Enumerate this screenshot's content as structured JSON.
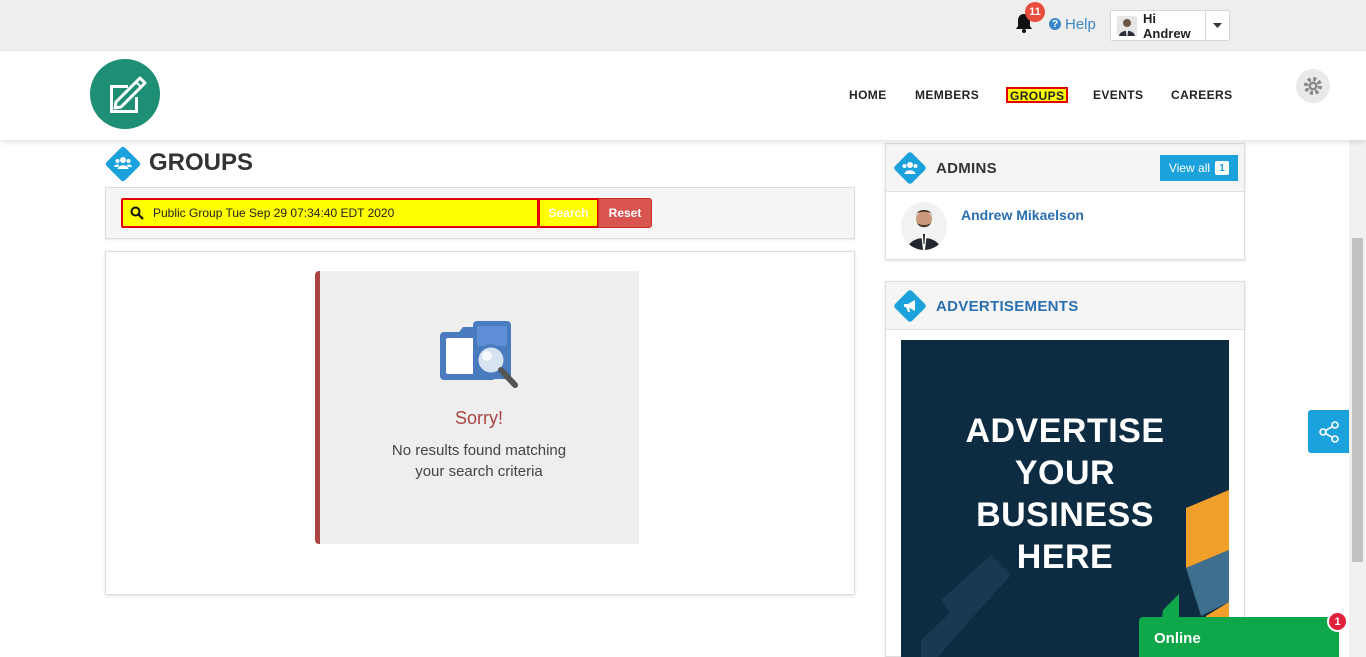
{
  "topbar": {
    "notification_count": "11",
    "help_label": "Help",
    "help_icon": "question-circle-icon",
    "user_greeting": "Hi Andrew"
  },
  "nav": {
    "items": [
      {
        "label": "HOME"
      },
      {
        "label": "MEMBERS"
      },
      {
        "label": "GROUPS",
        "active": true
      },
      {
        "label": "EVENTS"
      },
      {
        "label": "CAREERS"
      }
    ],
    "brand_color": "#1e8f74"
  },
  "page": {
    "title": "GROUPS"
  },
  "search": {
    "value": "Public Group Tue Sep 29 07:34:40 EDT 2020",
    "search_label": "Search",
    "reset_label": "Reset"
  },
  "results": {
    "heading": "Sorry!",
    "message_line1": "No results found matching",
    "message_line2": "your search criteria"
  },
  "admins": {
    "title": "ADMINS",
    "view_all_label": "View all",
    "count": "1",
    "list": [
      {
        "name": "Andrew Mikaelson"
      }
    ]
  },
  "ads": {
    "title": "ADVERTISEMENTS",
    "line1": "ADVERTISE",
    "line2": "YOUR",
    "line3": "BUSINESS",
    "line4": "HERE"
  },
  "chat": {
    "status_label": "Online",
    "unread_count": "1"
  },
  "colors": {
    "accent": "#1ba1dc",
    "danger": "#d9534f",
    "online": "#0ea84b",
    "highlight": "#ffff00"
  }
}
